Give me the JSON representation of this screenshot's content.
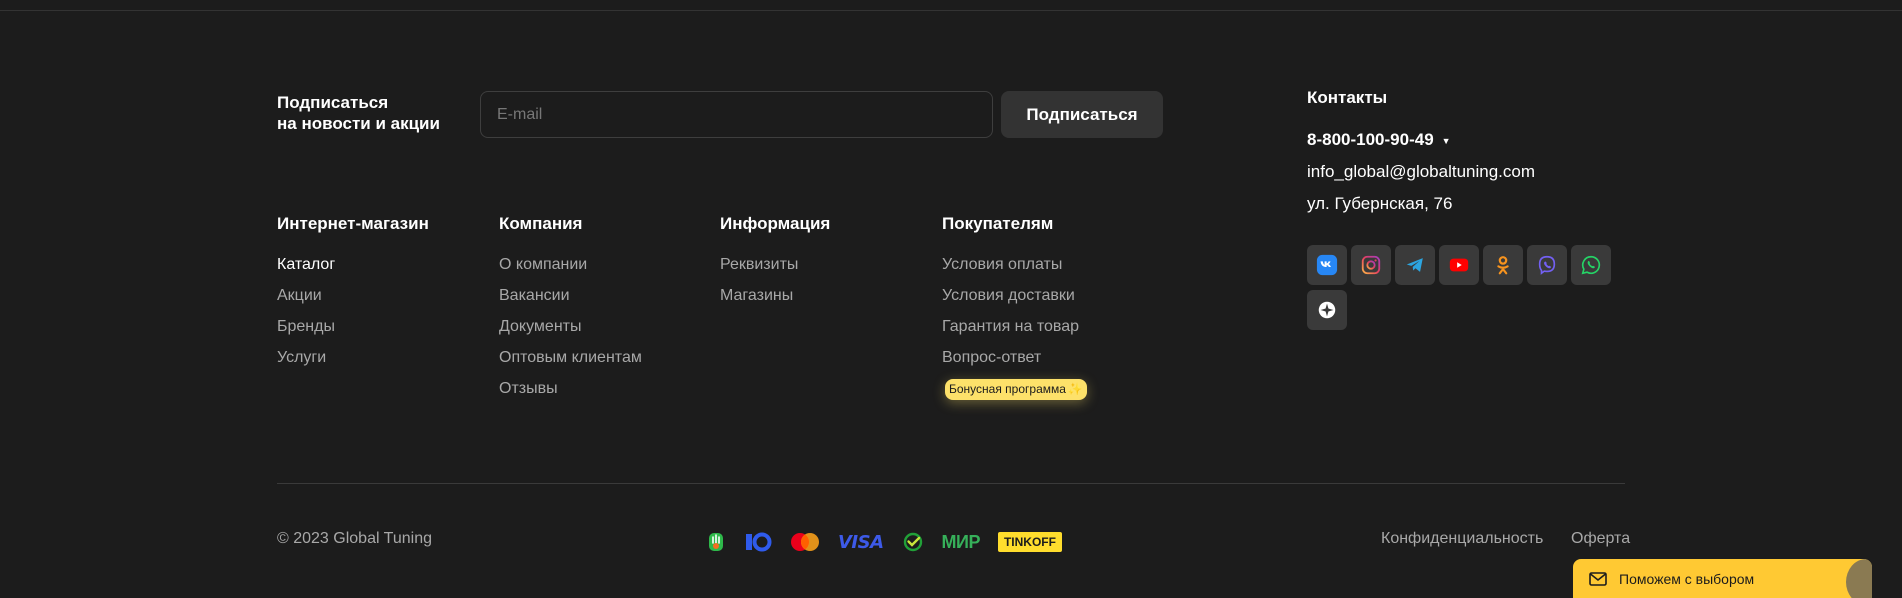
{
  "subscribe": {
    "title_line1": "Подписаться",
    "title_line2": "на новости и акции",
    "email_placeholder": "E-mail",
    "button": "Подписаться"
  },
  "columns": [
    {
      "title": "Интернет-магазин",
      "items": [
        "Каталог",
        "Акции",
        "Бренды",
        "Услуги"
      ]
    },
    {
      "title": "Компания",
      "items": [
        "О компании",
        "Вакансии",
        "Документы",
        "Оптовым клиентам",
        "Отзывы"
      ]
    },
    {
      "title": "Информация",
      "items": [
        "Реквизиты",
        "Магазины"
      ]
    },
    {
      "title": "Покупателям",
      "items": [
        "Условия оплаты",
        "Условия доставки",
        "Гарантия на товар",
        "Вопрос-ответ"
      ],
      "badge": "Бонусная программа"
    }
  ],
  "contacts": {
    "title": "Контакты",
    "phone": "8-800-100-90-49",
    "email": "info_global@globaltuning.com",
    "address": "ул. Губернская, 76"
  },
  "socials": [
    "vk-icon",
    "instagram-icon",
    "telegram-icon",
    "youtube-icon",
    "odnoklassniki-icon",
    "viber-icon",
    "whatsapp-icon",
    "compass-icon"
  ],
  "footer": {
    "copyright": "© 2023 Global Tuning",
    "payments": {
      "visa": "VISA",
      "mir": "МИР",
      "tinkoff": "TINKOFF"
    },
    "privacy": "Конфиденциальность",
    "offer": "Оферта"
  },
  "help_widget": {
    "label": "Поможем с выбором"
  },
  "colors": {
    "background": "#1c1c1c",
    "accent": "#ffc933",
    "muted_text": "#a8a8a8"
  }
}
